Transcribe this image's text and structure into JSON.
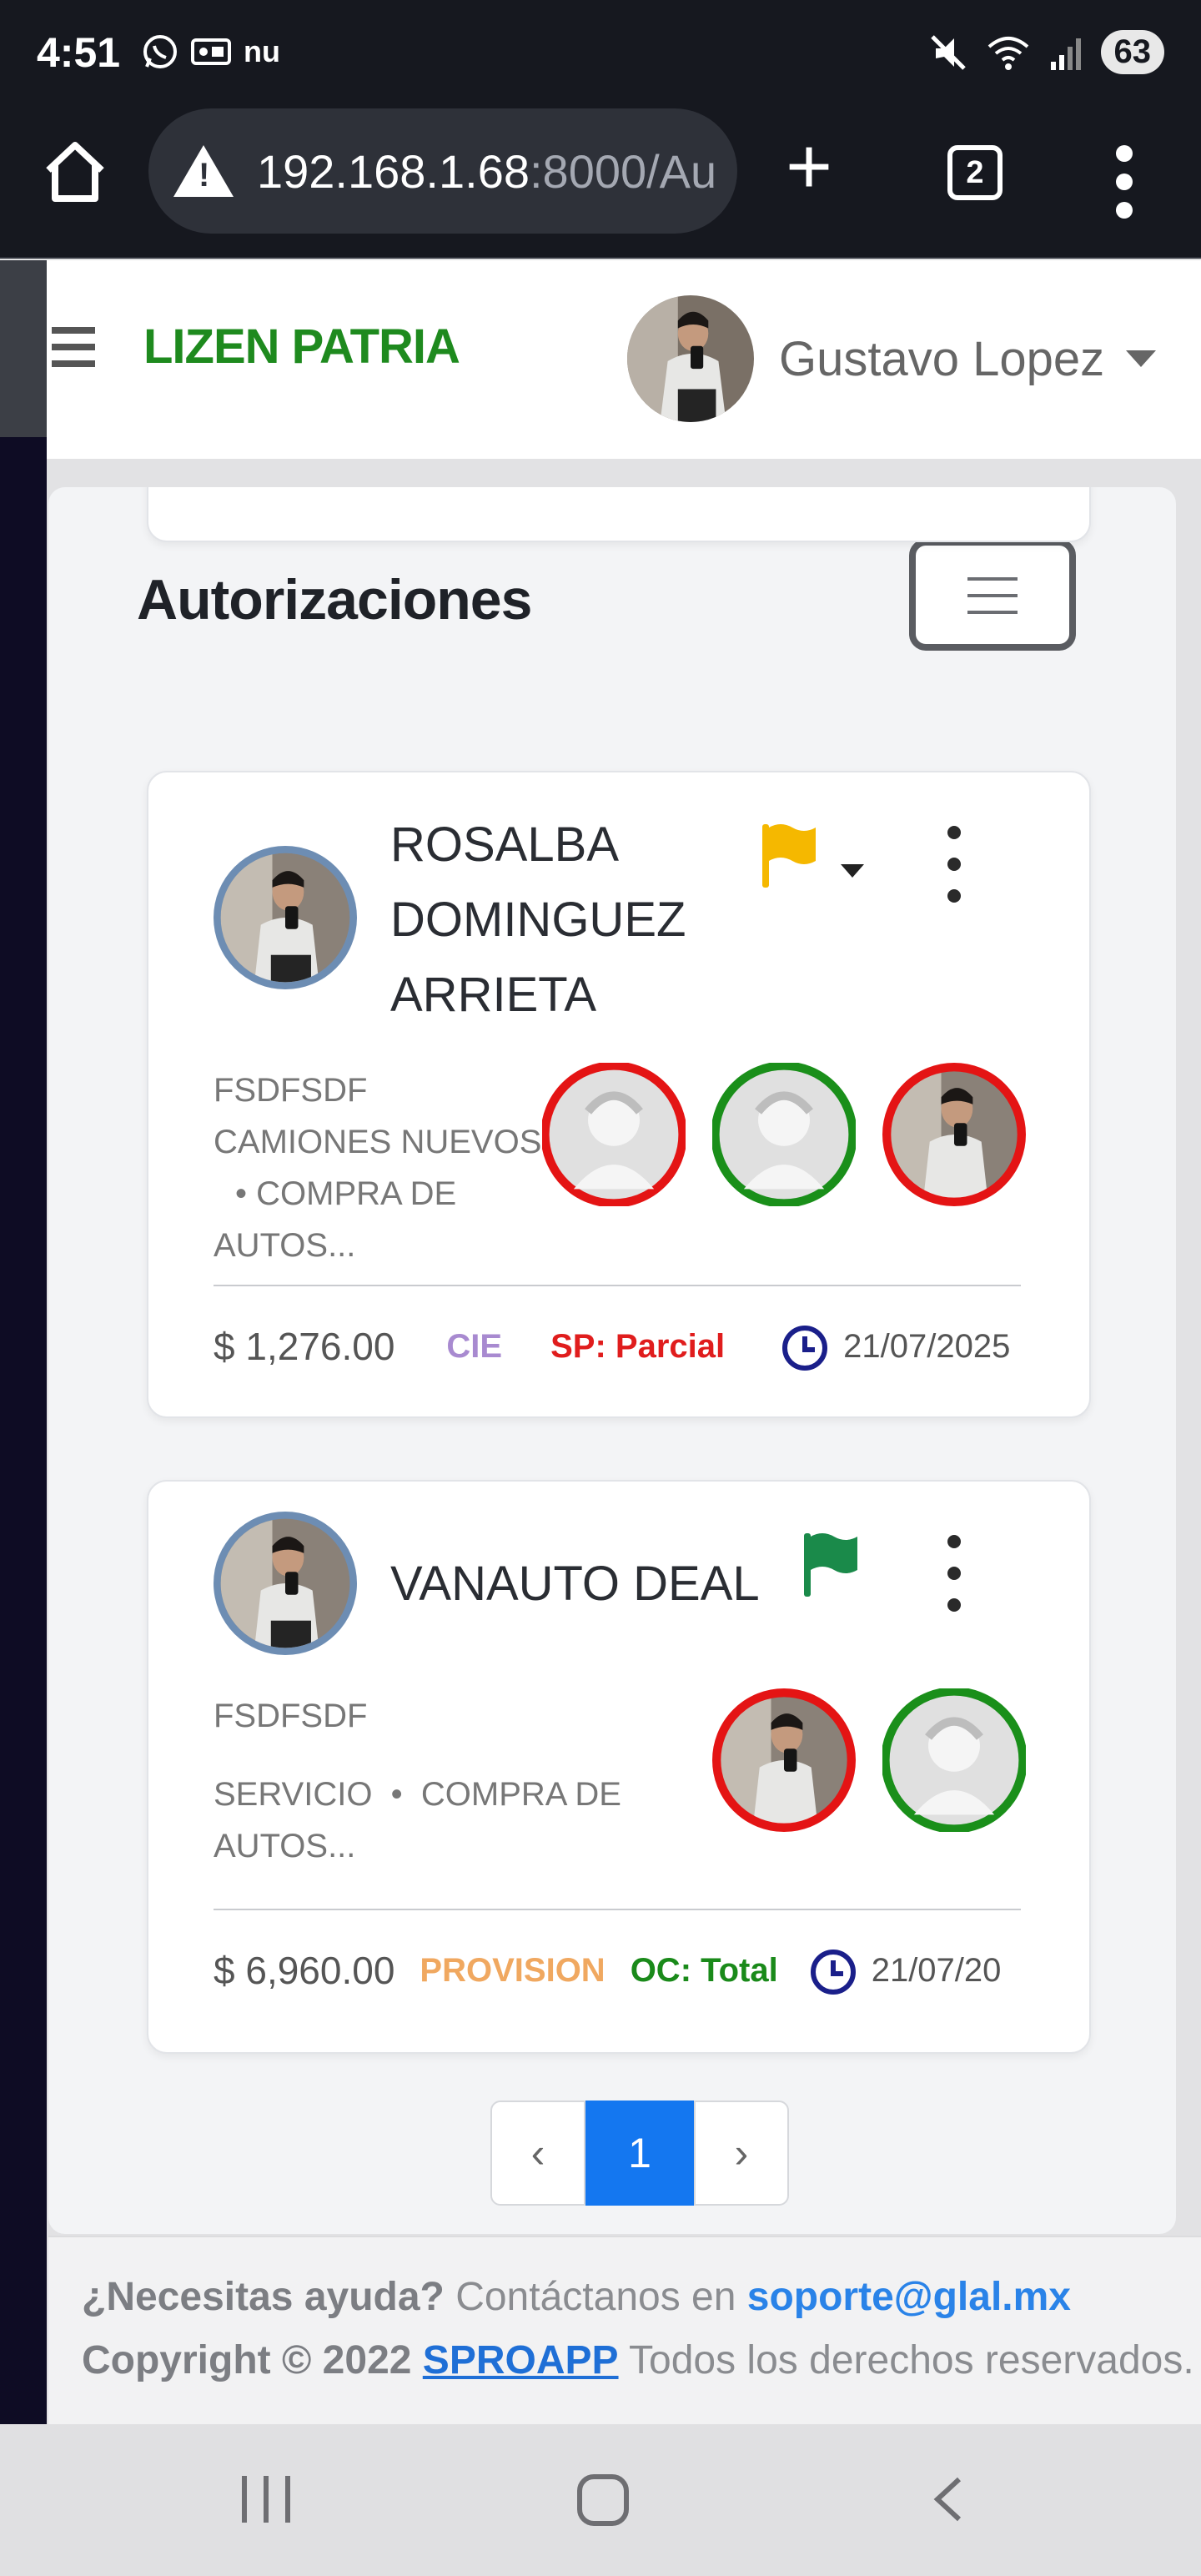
{
  "status_bar": {
    "time": "4:51",
    "notifications": [
      "whatsapp-icon",
      "voicemail-icon",
      "nu-icon"
    ],
    "nu_label": "nu",
    "battery": "63"
  },
  "browser": {
    "url_host": "192.168.1.68",
    "url_rest": ":8000/Au",
    "tab_count": "2"
  },
  "app_header": {
    "brand": "LIZEN PATRIA",
    "user_name": "Gustavo Lopez",
    "brand_color": "#1e8a1e"
  },
  "page": {
    "title": "Autorizaciones"
  },
  "cards": [
    {
      "name_lines": [
        "ROSALBA",
        "DOMINGUEZ",
        "ARRIETA"
      ],
      "flag_color": "#f5b800",
      "desc": "FSDFSDF",
      "sub_lines": [
        "CAMIONES NUEVOS",
        "• COMPRA DE",
        "AUTOS..."
      ],
      "approvers": [
        {
          "type": "placeholder",
          "status_color": "#e41414"
        },
        {
          "type": "placeholder",
          "status_color": "#1a8f1a"
        },
        {
          "type": "photo",
          "status_color": "#e41414"
        }
      ],
      "amount": "$ 1,276.00",
      "tag1": {
        "text": "CIE",
        "color": "#a88ad0"
      },
      "tag2": {
        "text": "SP: Parcial",
        "color": "#e01d1d"
      },
      "date": "21/07/2025"
    },
    {
      "name_lines": [
        "VANAUTO DEAL"
      ],
      "flag_color": "#1a8a4a",
      "desc": "FSDFSDF",
      "sub_lines": [
        "SERVICIO  •  COMPRA DE",
        "AUTOS..."
      ],
      "approvers": [
        {
          "type": "photo",
          "status_color": "#e41414"
        },
        {
          "type": "placeholder",
          "status_color": "#1a8f1a"
        }
      ],
      "amount": "$ 6,960.00",
      "tag1": {
        "text": "PROVISION",
        "color": "#f0a860"
      },
      "tag2": {
        "text": "OC: Total",
        "color": "#1a8a1a"
      },
      "date": "21/07/20"
    }
  ],
  "pagination": {
    "prev": "‹",
    "current": "1",
    "next": "›"
  },
  "footer": {
    "help_question": "¿Necesitas ayuda?",
    "help_text": " Contáctanos en ",
    "email": "soporte@glal.mx",
    "copyright": "Copyright © 2022 ",
    "company": "SPROAPP",
    "rights": " Todos los derechos reservados."
  }
}
